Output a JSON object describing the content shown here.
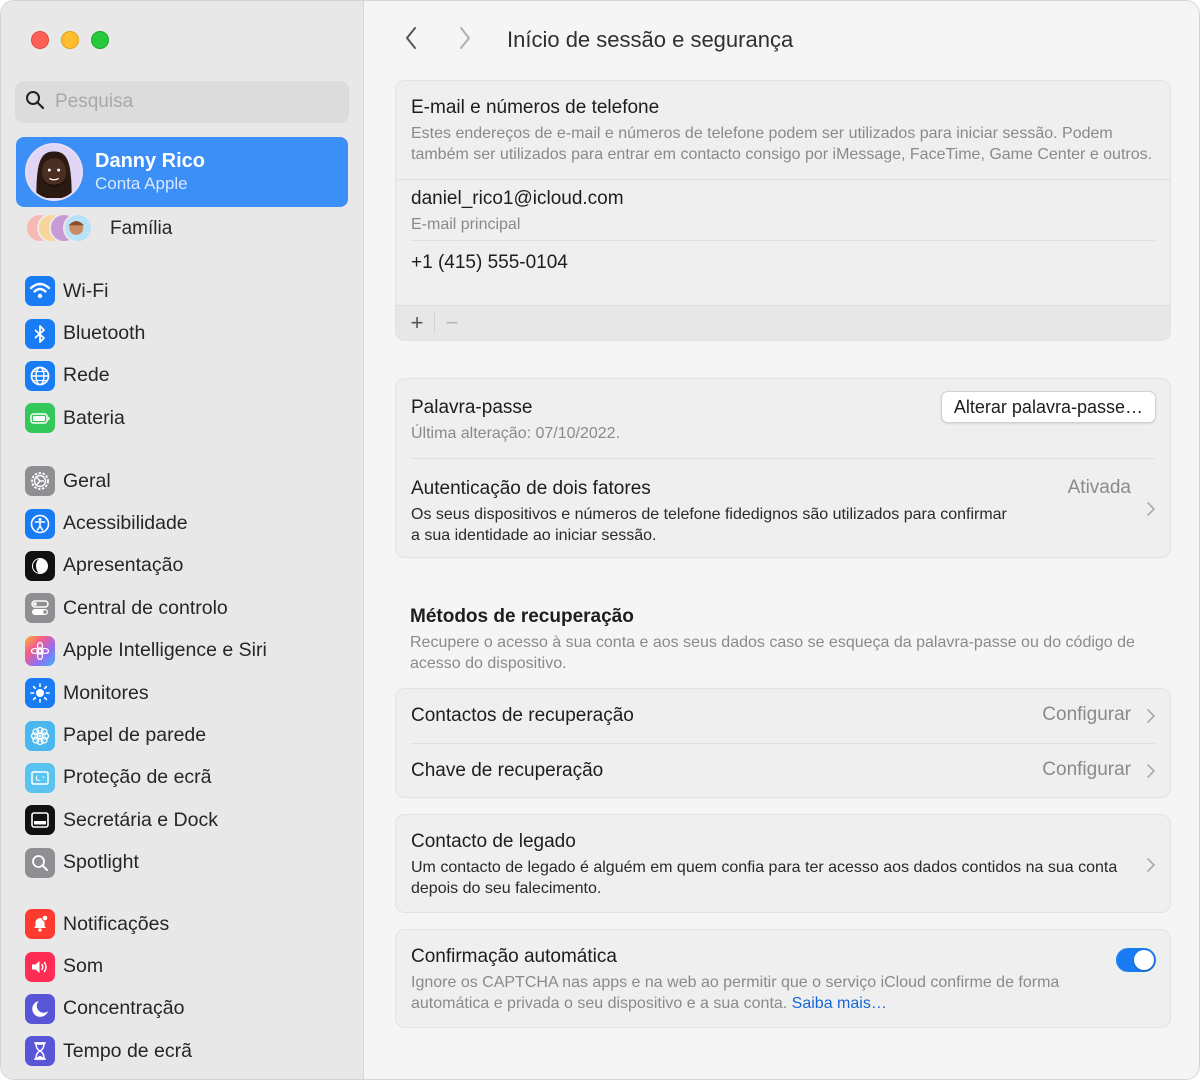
{
  "window": {
    "traffic_lights": [
      "close",
      "minimize",
      "maximize"
    ]
  },
  "sidebar": {
    "search": {
      "placeholder": "Pesquisa",
      "value": ""
    },
    "account": {
      "name": "Danny Rico",
      "subtitle": "Conta Apple",
      "avatar_icon": "memoji-avatar"
    },
    "family": {
      "label": "Família",
      "icon": "family-avatars"
    },
    "groups": [
      [
        {
          "label": "Wi-Fi",
          "icon": "wifi-icon",
          "color": "#1a7cf5"
        },
        {
          "label": "Bluetooth",
          "icon": "bluetooth-icon",
          "color": "#1a7cf5"
        },
        {
          "label": "Rede",
          "icon": "globe-icon",
          "color": "#1a7cf5"
        },
        {
          "label": "Bateria",
          "icon": "battery-icon",
          "color": "#34c759"
        }
      ],
      [
        {
          "label": "Geral",
          "icon": "gear-icon",
          "color": "#8e8e93"
        },
        {
          "label": "Acessibilidade",
          "icon": "accessibility-icon",
          "color": "#1a7cf5"
        },
        {
          "label": "Apresentação",
          "icon": "appearance-icon",
          "color": "#111111"
        },
        {
          "label": "Central de controlo",
          "icon": "control-center-icon",
          "color": "#8e8e93"
        },
        {
          "label": "Apple Intelligence e Siri",
          "icon": "siri-icon",
          "color": "#f08a5d"
        },
        {
          "label": "Monitores",
          "icon": "sun-icon",
          "color": "#1a7cf5"
        },
        {
          "label": "Papel de parede",
          "icon": "flower-icon",
          "color": "#4ab7ef"
        },
        {
          "label": "Proteção de ecrã",
          "icon": "screensaver-icon",
          "color": "#5ac3f0"
        },
        {
          "label": "Secretária e Dock",
          "icon": "dock-icon",
          "color": "#111111"
        },
        {
          "label": "Spotlight",
          "icon": "spotlight-icon",
          "color": "#8e8e93"
        }
      ],
      [
        {
          "label": "Notificações",
          "icon": "bell-icon",
          "color": "#ff3b30"
        },
        {
          "label": "Som",
          "icon": "speaker-icon",
          "color": "#ff2d55"
        },
        {
          "label": "Concentração",
          "icon": "moon-icon",
          "color": "#5856d6"
        },
        {
          "label": "Tempo de ecrã",
          "icon": "hourglass-icon",
          "color": "#5856d6"
        }
      ]
    ]
  },
  "header": {
    "title": "Início de sessão e segurança",
    "back_icon": "chevron-left-icon",
    "forward_icon": "chevron-right-icon"
  },
  "email_section": {
    "title": "E-mail e números de telefone",
    "description": "Estes endereços de e-mail e números de telefone podem ser utilizados para iniciar sessão. Podem também ser utilizados para entrar em contacto consigo por iMessage, FaceTime, Game Center e outros.",
    "entries": [
      {
        "value": "daniel_rico1@icloud.com",
        "label": "E-mail principal"
      },
      {
        "value": "+1 (415) 555-0104",
        "label": ""
      }
    ],
    "add_label": "+",
    "remove_label": "−"
  },
  "password_section": {
    "title": "Palavra-passe",
    "last_changed": "Última alteração: 07/10/2022.",
    "change_button": "Alterar palavra-passe…",
    "two_factor": {
      "title": "Autenticação de dois fatores",
      "status": "Ativada",
      "description": "Os seus dispositivos e números de telefone fidedignos são utilizados para confirmar a sua identidade ao iniciar sessão."
    }
  },
  "recovery": {
    "heading": "Métodos de recuperação",
    "description": "Recupere o acesso à sua conta e aos seus dados caso se esqueça da palavra-passe ou do código de acesso do dispositivo.",
    "items": [
      {
        "label": "Contactos de recuperação",
        "value": "Configurar"
      },
      {
        "label": "Chave de recuperação",
        "value": "Configurar"
      }
    ]
  },
  "legacy": {
    "title": "Contacto de legado",
    "description": "Um contacto de legado é alguém em quem confia para ter acesso aos dados contidos na sua conta depois do seu falecimento."
  },
  "auto_verify": {
    "title": "Confirmação automática",
    "description": "Ignore os CAPTCHA nas apps e na web ao permitir que o serviço iCloud confirme de forma automática e privada o seu dispositivo e a sua conta.",
    "link": "Saiba mais…",
    "enabled": true,
    "accent": "#1a7cf5"
  }
}
